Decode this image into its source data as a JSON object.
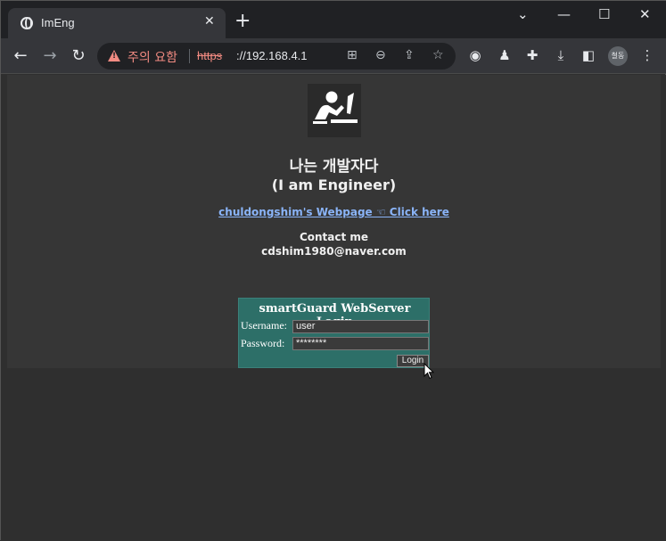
{
  "browser": {
    "tab_title": "ImEng",
    "tab_close": "✕",
    "new_tab": "+",
    "window_controls": {
      "chevron": "⌄",
      "minimize": "—",
      "maximize": "☐",
      "close": "✕"
    },
    "security_warning": "주의 요함",
    "url_protocol": "https",
    "url_host": "://192.168.4.1",
    "profile_label": "철동"
  },
  "page": {
    "headline_korean": "나는 개발자다",
    "headline_english": "(I am Engineer)",
    "webpage_link": "chuldongshim's Webpage ☜ Click here",
    "contact_heading": "Contact me",
    "contact_email": "cdshim1980@naver.com"
  },
  "login": {
    "title": "smartGuard WebServer Login",
    "username_label": "Username:",
    "username_value": "user",
    "password_label": "Password:",
    "password_value": "********",
    "button_label": "Login"
  },
  "colors": {
    "page_bg": "#2f2f2f",
    "panel_bg": "#363636",
    "login_bg": "#2d6f68",
    "link": "#8ab4f8",
    "warning": "#f28b82"
  }
}
